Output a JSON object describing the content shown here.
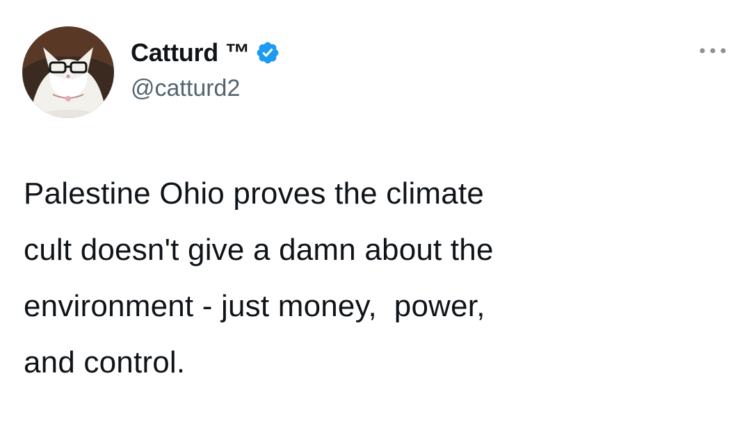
{
  "author": {
    "display_name": "Catturd ™",
    "handle": "@catturd2",
    "verified": true,
    "avatar_icon": "cat-with-glasses-avatar"
  },
  "tweet": {
    "text": "Palestine Ohio proves the climate\ncult doesn't give a damn about the\nenvironment - just money,  power,\nand control."
  },
  "icons": {
    "verified": "verified-badge-icon",
    "more": "more-options-icon"
  },
  "colors": {
    "background": "#ffffff",
    "text": "#0f1419",
    "secondary_text": "#536471",
    "verified_blue": "#1d9bf0"
  }
}
